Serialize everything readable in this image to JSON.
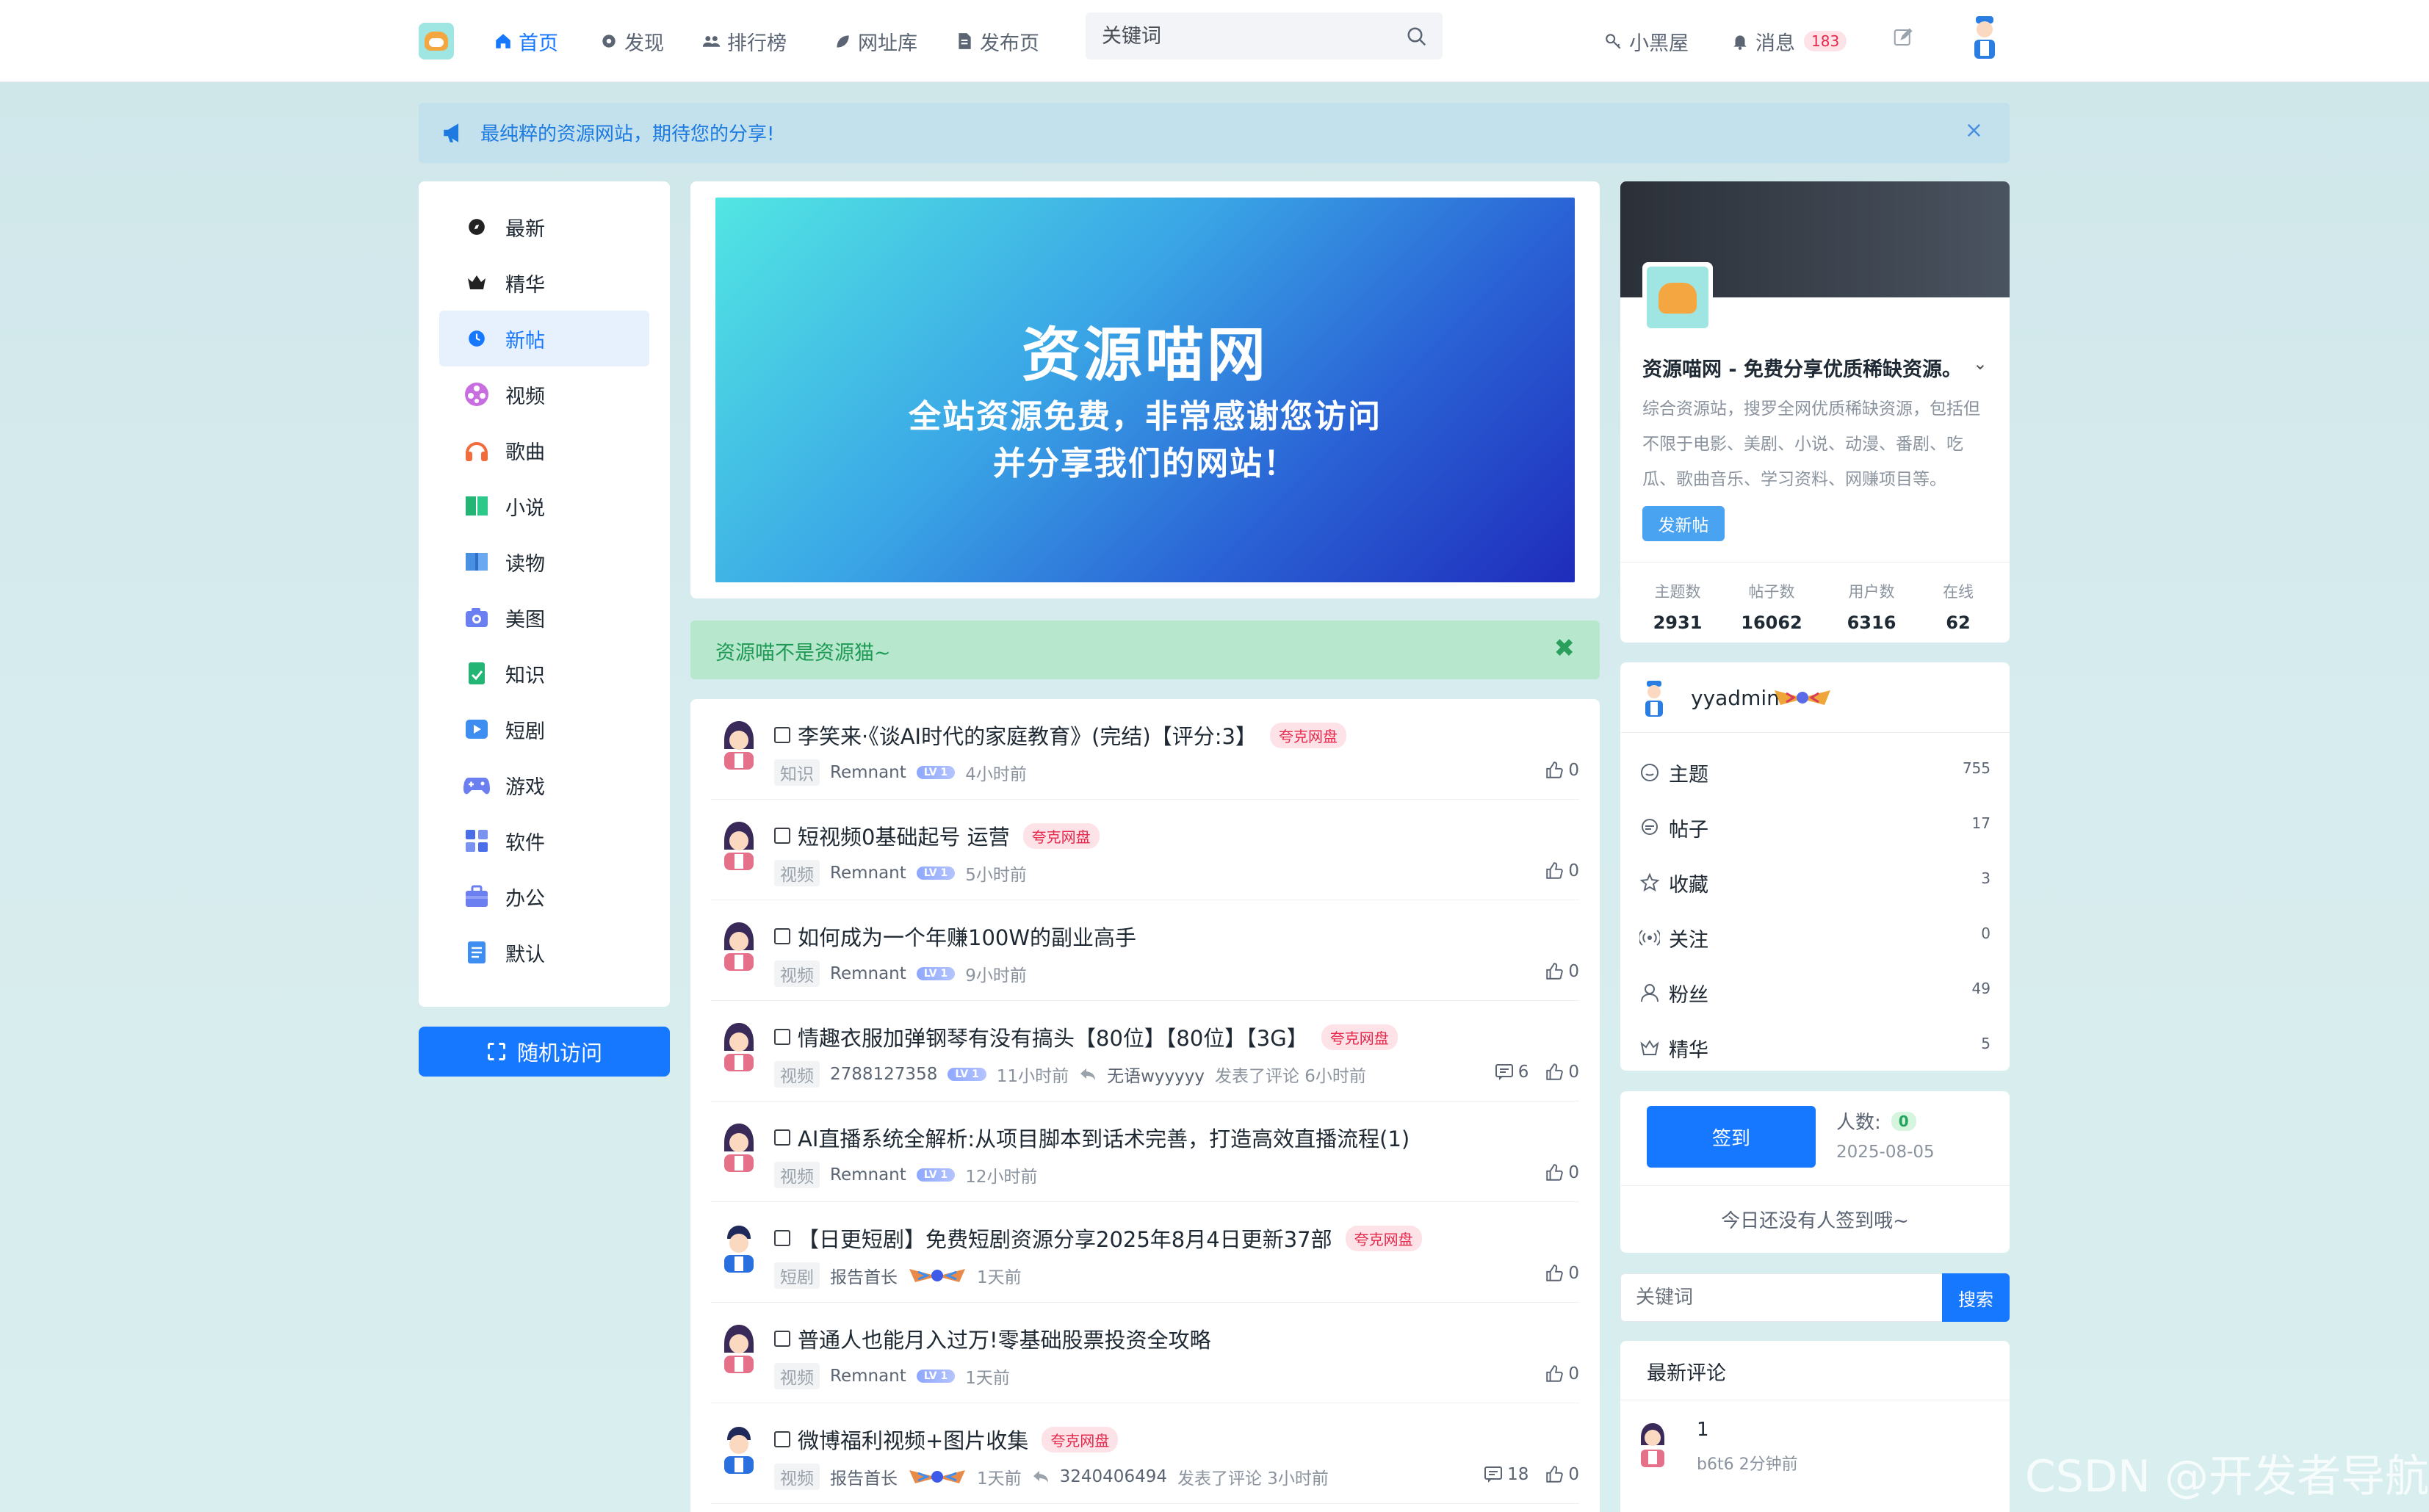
{
  "topnav": {
    "items": [
      {
        "label": "首页",
        "icon": "home-icon",
        "active": true
      },
      {
        "label": "发现",
        "icon": "gear-icon"
      },
      {
        "label": "排行榜",
        "icon": "users-icon"
      },
      {
        "label": "网址库",
        "icon": "leaf-icon"
      },
      {
        "label": "发布页",
        "icon": "file-icon"
      }
    ],
    "search_placeholder": "关键词",
    "blackroom": "小黑屋",
    "messages": "消息",
    "message_count": "183"
  },
  "notice": {
    "text": "最纯粹的资源网站，期待您的分享!",
    "close": "×"
  },
  "categories": [
    {
      "label": "最新",
      "icon": "compass-icon"
    },
    {
      "label": "精华",
      "icon": "crown-icon"
    },
    {
      "label": "新帖",
      "icon": "clock-icon",
      "active": true
    },
    {
      "label": "视频",
      "icon": "film-reel-icon"
    },
    {
      "label": "歌曲",
      "icon": "headphones-icon"
    },
    {
      "label": "小说",
      "icon": "book-icon"
    },
    {
      "label": "读物",
      "icon": "open-book-icon"
    },
    {
      "label": "美图",
      "icon": "camera-icon"
    },
    {
      "label": "知识",
      "icon": "notebook-icon"
    },
    {
      "label": "短剧",
      "icon": "video-icon"
    },
    {
      "label": "游戏",
      "icon": "gamepad-icon"
    },
    {
      "label": "软件",
      "icon": "grid-icon"
    },
    {
      "label": "办公",
      "icon": "briefcase-icon"
    },
    {
      "label": "默认",
      "icon": "document-icon"
    }
  ],
  "random_visit": "随机访问",
  "banner": {
    "title": "资源喵网",
    "line1": "全站资源免费，非常感谢您访问",
    "line2": "并分享我们的网站！"
  },
  "greenbar": {
    "text": "资源喵不是资源猫~",
    "close": "✖"
  },
  "posts": [
    {
      "title": "李笑来·《谈AI时代的家庭教育》(完结)【评分:3】",
      "tag": "夸克网盘",
      "category": "知识",
      "user": "Remnant",
      "badge": "lv",
      "time": "4小时前",
      "likes": "0",
      "avatar": "girl"
    },
    {
      "title": "短视频0基础起号 运营",
      "tag": "夸克网盘",
      "category": "视频",
      "user": "Remnant",
      "badge": "lv",
      "time": "5小时前",
      "likes": "0",
      "avatar": "girl"
    },
    {
      "title": "如何成为一个年赚100W的副业高手",
      "tag": "",
      "category": "视频",
      "user": "Remnant",
      "badge": "lv",
      "time": "9小时前",
      "likes": "0",
      "avatar": "girl"
    },
    {
      "title": "情趣衣服加弹钢琴有没有搞头【80位】【80位】【3G】",
      "tag": "夸克网盘",
      "category": "视频",
      "user": "2788127358",
      "badge": "lv",
      "time": "11小时前",
      "reply_user": "无语wyyyyy",
      "reply_text": "发表了评论 6小时前",
      "comments": "6",
      "likes": "0",
      "avatar": "girl"
    },
    {
      "title": "AI直播系统全解析:从项目脚本到话术完善，打造高效直播流程(1)",
      "tag": "",
      "category": "视频",
      "user": "Remnant",
      "badge": "lv",
      "time": "12小时前",
      "likes": "0",
      "avatar": "girl"
    },
    {
      "title": "【日更短剧】免费短剧资源分享2025年8月4日更新37部",
      "tag": "夸克网盘",
      "category": "短剧",
      "user": "报告首长",
      "badge": "medal",
      "time": "1天前",
      "likes": "0",
      "avatar": "boy"
    },
    {
      "title": "普通人也能月入过万!零基础股票投资全攻略",
      "tag": "",
      "category": "视频",
      "user": "Remnant",
      "badge": "lv",
      "time": "1天前",
      "likes": "0",
      "avatar": "girl"
    },
    {
      "title": "微博福利视频+图片收集",
      "tag": "夸克网盘",
      "category": "视频",
      "user": "报告首长",
      "badge": "medal",
      "time": "1天前",
      "reply_user": "3240406494",
      "reply_text": "发表了评论 3小时前",
      "comments": "18",
      "likes": "0",
      "avatar": "boy"
    }
  ],
  "lv_text": "LV 1",
  "site": {
    "name": "资源喵网 - 免费分享优质稀缺资源。",
    "desc": "综合资源站，搜罗全网优质稀缺资源，包括但不限于电影、美剧、小说、动漫、番剧、吃瓜、歌曲音乐、学习资料、网赚项目等。",
    "newpost": "发新帖",
    "stats": [
      {
        "label": "主题数",
        "value": "2931"
      },
      {
        "label": "帖子数",
        "value": "16062"
      },
      {
        "label": "用户数",
        "value": "6316"
      },
      {
        "label": "在线",
        "value": "62"
      }
    ]
  },
  "user": {
    "name": "yyadmin",
    "rows": [
      {
        "label": "主题",
        "value": "755",
        "icon": "chat-icon"
      },
      {
        "label": "帖子",
        "value": "17",
        "icon": "comments-icon"
      },
      {
        "label": "收藏",
        "value": "3",
        "icon": "star-icon"
      },
      {
        "label": "关注",
        "value": "0",
        "icon": "broadcast-icon"
      },
      {
        "label": "粉丝",
        "value": "49",
        "icon": "user-icon"
      },
      {
        "label": "精华",
        "value": "5",
        "icon": "crown-outline-icon"
      }
    ]
  },
  "sign": {
    "button": "签到",
    "count_label": "人数:",
    "count": "0",
    "date": "2025-08-05",
    "none": "今日还没有人签到哦~"
  },
  "rsearch": {
    "placeholder": "关键词",
    "button": "搜索"
  },
  "latest": {
    "title": "最新评论",
    "text": "1",
    "meta": "b6t6 2分钟前"
  },
  "watermark": "CSDN @开发者导航"
}
